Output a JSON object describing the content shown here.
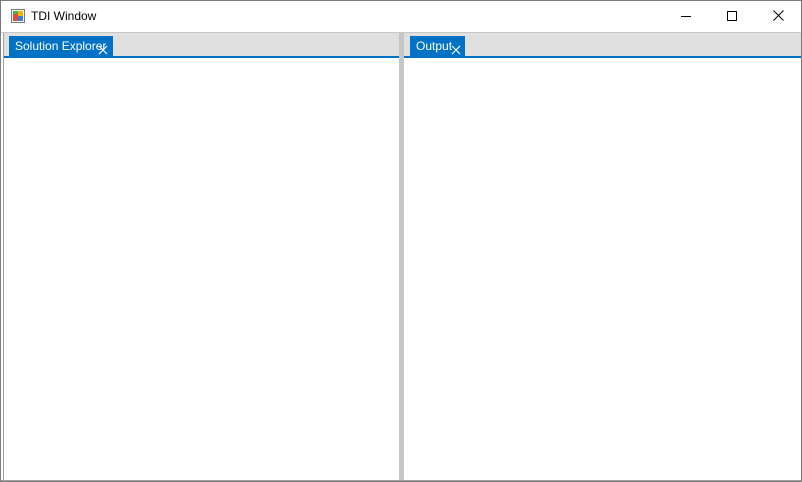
{
  "window": {
    "title": "TDI Window",
    "icon": "app-window-icon",
    "controls": {
      "minimize_icon": "minimize-icon",
      "maximize_icon": "maximize-icon",
      "close_icon": "close-icon"
    }
  },
  "panes": {
    "left": {
      "tab_label": "Solution Explorer",
      "close_icon": "tab-close-icon"
    },
    "right": {
      "tab_label": "Output",
      "close_icon": "tab-close-icon"
    }
  },
  "colors": {
    "accent": "#0072c6",
    "tabstrip_background": "#e0e0e0",
    "splitter": "#c6c6c6",
    "tab_text": "#ffffff"
  }
}
